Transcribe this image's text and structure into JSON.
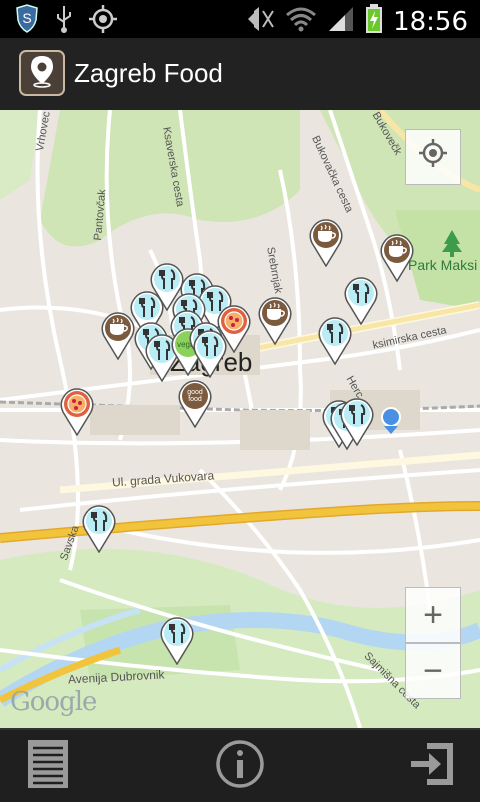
{
  "status_bar": {
    "time": "18:56",
    "icons": [
      "shield-icon",
      "usb-icon",
      "gps-icon",
      "mute-icon",
      "wifi-icon",
      "signal-icon",
      "battery-charging-icon"
    ]
  },
  "app_bar": {
    "title": "Zagreb Food",
    "icon": "map-pin-icon"
  },
  "map": {
    "city_label": "Zagreb",
    "place_label": "Park Maksi",
    "streets": [
      "Vrhovec",
      "Pantovčak",
      "Ksaverska cesta",
      "Bukovačka cesta",
      "Bukovečk",
      "Srebrnjak",
      "ksimirska cesta",
      "Herc",
      "Ul. grada Vukovara",
      "Savska",
      "Avenija Dubrovnik",
      "Sajmišna cesta"
    ],
    "pin_types": {
      "coffee": "coffee-cup-icon",
      "restaurant": "fork-knife-icon",
      "pizza": "pizza-icon",
      "good_food": "good-food-logo-icon",
      "vegan": "vegan-icon"
    },
    "good_food_text": "good food",
    "vegan_text": "vegan",
    "attribution": "Google",
    "controls": {
      "locate": "my-location-icon",
      "zoom_in": "+",
      "zoom_out": "−"
    }
  },
  "bottom_bar": {
    "items": [
      "list-icon",
      "info-icon",
      "exit-icon"
    ]
  },
  "colors": {
    "coffee": "#7b5a3e",
    "restaurant": "#b9ecf5",
    "pizza": "#e06040",
    "highway": "#f2c43c",
    "river": "#b3d7f2"
  }
}
